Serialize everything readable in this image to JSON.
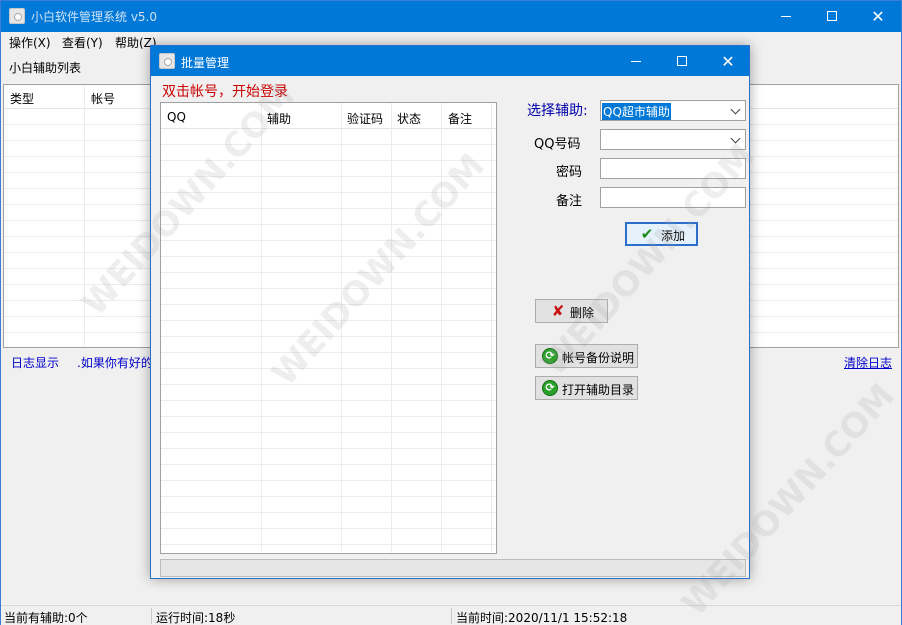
{
  "main_window": {
    "title": "小白软件管理系统    v5.0",
    "menu": [
      "操作(X)",
      "查看(Y)",
      "帮助(Z)"
    ],
    "list_label": "小白辅助列表",
    "list_columns": [
      "类型",
      "帐号"
    ],
    "log_label": "日志显示",
    "log_notice": ".如果你有好的",
    "clear_log": "清除日志"
  },
  "status_bar": {
    "assist_count": "当前有辅助:0个",
    "run_time": "运行时间:18秒",
    "current_time": "当前时间:2020/11/1  15:52:18"
  },
  "dialog": {
    "title": "批量管理",
    "hint": "双击帐号，开始登录",
    "columns": [
      "QQ",
      "辅助",
      "验证码",
      "状态",
      "备注"
    ],
    "form": {
      "select_label": "选择辅助:",
      "select_value": "QQ超市辅助",
      "qq_label": "QQ号码",
      "qq_value": "",
      "pwd_label": "密码",
      "pwd_value": "",
      "note_label": "备注",
      "note_value": ""
    },
    "buttons": {
      "add": "添加",
      "delete": "删除",
      "backup": "帐号备份说明",
      "open_dir": "打开辅助目录"
    },
    "progress": 0
  },
  "watermark": "WEIDOWN.COM",
  "icons": {
    "add": "check-icon",
    "delete": "x-icon",
    "backup": "refresh-icon",
    "open_dir": "refresh-icon"
  },
  "colors": {
    "titlebar": "#0078d7",
    "hint": "#cc0000",
    "link": "#0000cc"
  }
}
